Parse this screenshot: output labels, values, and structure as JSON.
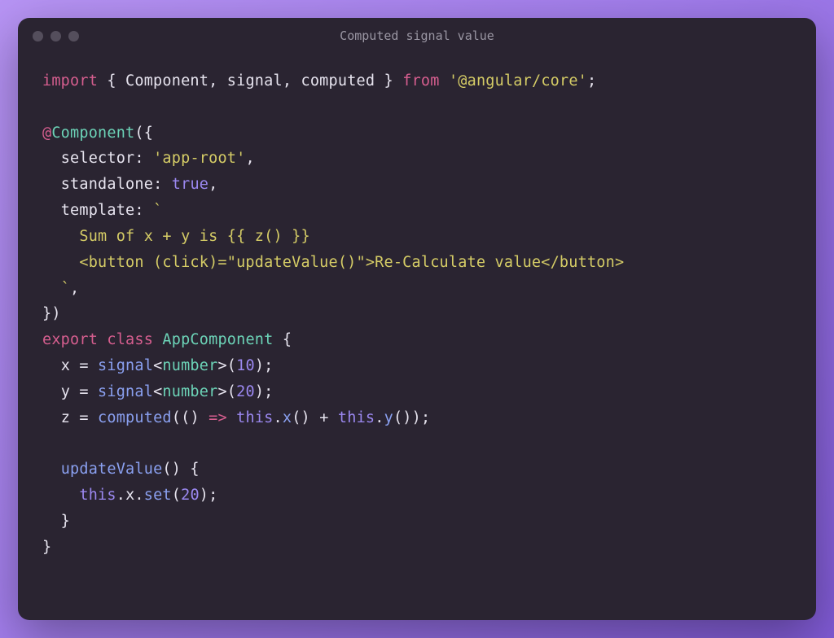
{
  "window": {
    "title": "Computed signal value"
  },
  "code": {
    "l1": {
      "a": "import",
      "b": " { ",
      "c": "Component",
      "d": ", ",
      "e": "signal",
      "f": ", ",
      "g": "computed",
      "h": " } ",
      "i": "from",
      "j": " ",
      "k": "'@angular/core'",
      "l": ";"
    },
    "l3": {
      "a": "@",
      "b": "Component",
      "c": "({"
    },
    "l4": {
      "a": "  ",
      "b": "selector",
      "c": ": ",
      "d": "'app-root'",
      "e": ","
    },
    "l5": {
      "a": "  ",
      "b": "standalone",
      "c": ": ",
      "d": "true",
      "e": ","
    },
    "l6": {
      "a": "  ",
      "b": "template",
      "c": ": ",
      "d": "`"
    },
    "l7": {
      "a": "    Sum of x + y is {{ z() }}"
    },
    "l8": {
      "a": "    <button (click)=\"updateValue()\">Re-Calculate value</button>"
    },
    "l9": {
      "a": "  ",
      "b": "`",
      "c": ","
    },
    "l10": {
      "a": "})"
    },
    "l11": {
      "a": "export",
      "b": " ",
      "c": "class",
      "d": " ",
      "e": "AppComponent",
      "f": " {"
    },
    "l12": {
      "a": "  ",
      "b": "x",
      "c": " = ",
      "d": "signal",
      "e": "<",
      "f": "number",
      "g": ">(",
      "h": "10",
      "i": ");"
    },
    "l13": {
      "a": "  ",
      "b": "y",
      "c": " = ",
      "d": "signal",
      "e": "<",
      "f": "number",
      "g": ">(",
      "h": "20",
      "i": ");"
    },
    "l14": {
      "a": "  ",
      "b": "z",
      "c": " = ",
      "d": "computed",
      "e": "(() ",
      "f": "=>",
      "g": " ",
      "h": "this",
      "i": ".",
      "j": "x",
      "k": "() + ",
      "l": "this",
      "m": ".",
      "n": "y",
      "o": "());"
    },
    "l16": {
      "a": "  ",
      "b": "updateValue",
      "c": "() {"
    },
    "l17": {
      "a": "    ",
      "b": "this",
      "c": ".",
      "d": "x",
      "e": ".",
      "f": "set",
      "g": "(",
      "h": "20",
      "i": ");"
    },
    "l18": {
      "a": "  }"
    },
    "l19": {
      "a": "}"
    }
  }
}
